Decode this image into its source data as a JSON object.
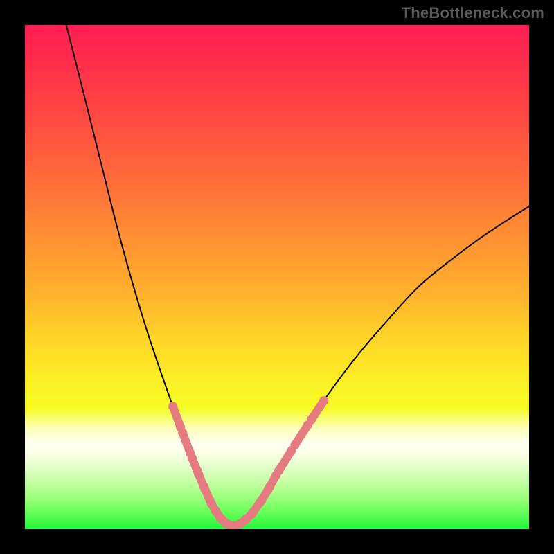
{
  "watermark": "TheBottleneck.com",
  "chart_data": {
    "type": "line",
    "title": "",
    "xlabel": "",
    "ylabel": "",
    "xlim": [
      0,
      100
    ],
    "ylim": [
      0,
      100
    ],
    "grid": false,
    "legend": false,
    "curve": {
      "name": "bottleneck-curve",
      "color": "#000000",
      "stroke_width": 2,
      "points": [
        {
          "x": 8.2,
          "y": 100.0
        },
        {
          "x": 11.5,
          "y": 87.0
        },
        {
          "x": 15.0,
          "y": 73.0
        },
        {
          "x": 18.0,
          "y": 61.0
        },
        {
          "x": 21.0,
          "y": 50.0
        },
        {
          "x": 24.0,
          "y": 40.0
        },
        {
          "x": 27.0,
          "y": 31.0
        },
        {
          "x": 30.0,
          "y": 22.5
        },
        {
          "x": 33.0,
          "y": 14.5
        },
        {
          "x": 35.0,
          "y": 9.5
        },
        {
          "x": 37.0,
          "y": 5.0
        },
        {
          "x": 38.5,
          "y": 2.5
        },
        {
          "x": 40.0,
          "y": 1.0
        },
        {
          "x": 41.5,
          "y": 0.5
        },
        {
          "x": 43.0,
          "y": 1.2
        },
        {
          "x": 45.0,
          "y": 3.0
        },
        {
          "x": 47.5,
          "y": 6.5
        },
        {
          "x": 50.0,
          "y": 11.0
        },
        {
          "x": 55.0,
          "y": 19.0
        },
        {
          "x": 60.0,
          "y": 26.5
        },
        {
          "x": 66.0,
          "y": 34.5
        },
        {
          "x": 72.0,
          "y": 41.5
        },
        {
          "x": 78.0,
          "y": 48.0
        },
        {
          "x": 84.0,
          "y": 53.0
        },
        {
          "x": 90.0,
          "y": 57.5
        },
        {
          "x": 96.0,
          "y": 61.5
        },
        {
          "x": 100.0,
          "y": 64.0
        }
      ]
    },
    "highlight_band": {
      "description": "emphasized overlay segments along the curve",
      "color": "#e57b80",
      "stroke_width": 12,
      "y_range": [
        0.5,
        25.5
      ]
    }
  },
  "colors": {
    "background": "#000000",
    "curve": "#000000",
    "highlight": "#e57b80",
    "watermark": "#5b5b5b"
  }
}
